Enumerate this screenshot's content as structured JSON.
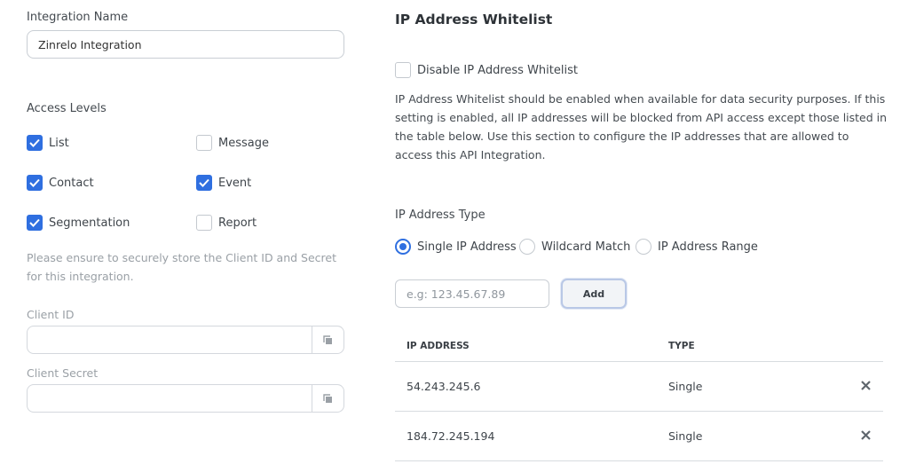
{
  "integration": {
    "name_label": "Integration Name",
    "name_value": "Zinrelo Integration"
  },
  "access": {
    "title": "Access Levels",
    "levels": [
      {
        "label": "List",
        "checked": true
      },
      {
        "label": "Message",
        "checked": false
      },
      {
        "label": "Contact",
        "checked": true
      },
      {
        "label": "Event",
        "checked": true
      },
      {
        "label": "Segmentation",
        "checked": true
      },
      {
        "label": "Report",
        "checked": false
      }
    ],
    "note": "Please ensure to securely store the Client ID and Secret for this integration."
  },
  "credentials": {
    "client_id_label": "Client ID",
    "client_id_value": "",
    "client_secret_label": "Client Secret",
    "client_secret_value": ""
  },
  "whitelist": {
    "title": "IP Address Whitelist",
    "disable_label": "Disable IP Address Whitelist",
    "disable_checked": false,
    "description": "IP Address Whitelist should be enabled when available for data security purposes. If this setting is enabled, all IP addresses will be blocked from API access except those listed in the table below. Use this section to configure the IP addresses that are allowed to access this API Integration.",
    "type_label": "IP Address Type",
    "types": [
      {
        "label": "Single IP Address",
        "selected": true
      },
      {
        "label": "Wildcard Match",
        "selected": false
      },
      {
        "label": "IP Address Range",
        "selected": false
      }
    ],
    "ip_placeholder": "e.g: 123.45.67.89",
    "add_label": "Add",
    "table": {
      "columns": [
        "IP ADDRESS",
        "TYPE"
      ],
      "rows": [
        {
          "ip": "54.243.245.6",
          "type": "Single"
        },
        {
          "ip": "184.72.245.194",
          "type": "Single"
        }
      ]
    }
  },
  "colors": {
    "accent": "#2f6fe0"
  },
  "icons": {
    "checkbox_check": "check-icon",
    "copy": "copy-icon",
    "delete": "close-icon"
  }
}
